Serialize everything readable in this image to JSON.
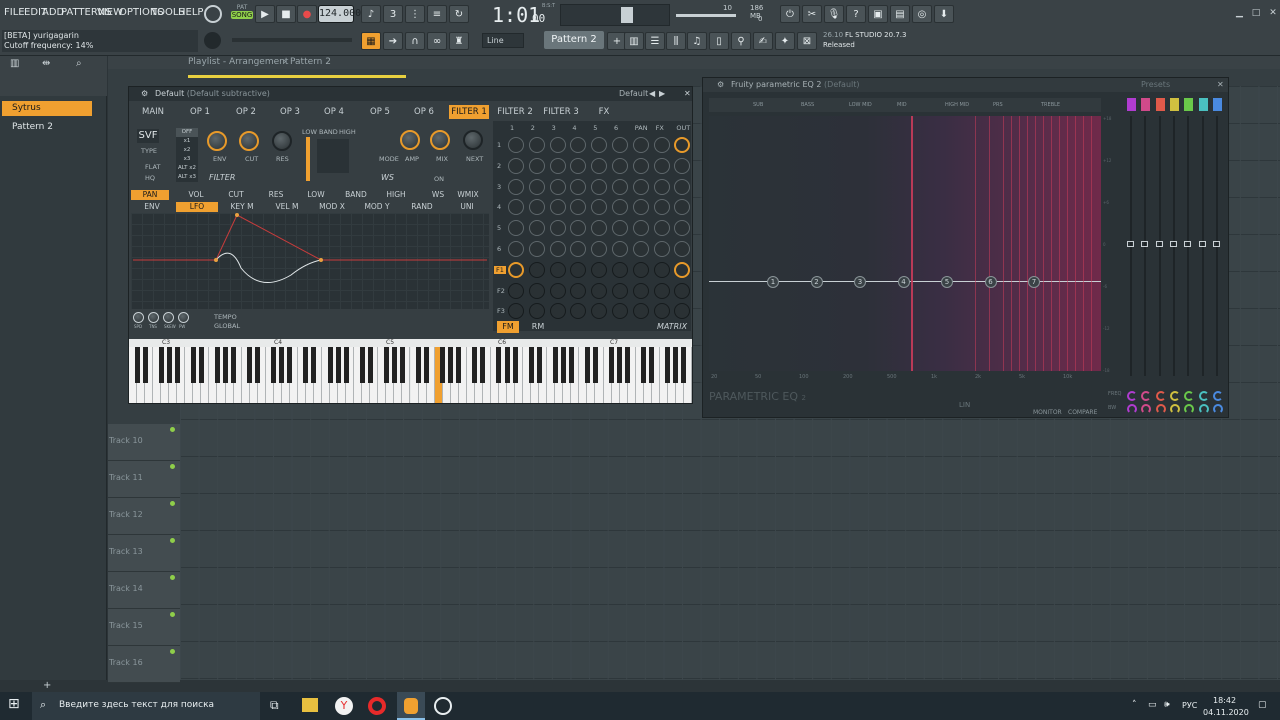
{
  "menubar": {
    "items": [
      "FILE",
      "EDIT",
      "ADD",
      "PATTERNS",
      "VIEW",
      "OPTIONS",
      "TOOLS",
      "HELP"
    ]
  },
  "transport": {
    "mode": "SONG",
    "mode_above": "PAT",
    "tempo": "124.000",
    "time": "1:01",
    "time_small": "00",
    "time_sig": "B:S:T",
    "memory": "186 MB",
    "cpu": "10",
    "voices": "0"
  },
  "hint": {
    "user": "[BETA] yurigagarin",
    "param": "Cutoff frequency: 14%"
  },
  "toolbar2": {
    "snap": "Line",
    "pattern": "Pattern 2"
  },
  "news": {
    "date": "26.10",
    "title": "FL STUDIO 20.7.3",
    "status": "Released"
  },
  "browser": {
    "items": [
      {
        "label": "Sytrus",
        "active": true
      },
      {
        "label": "Pattern 2",
        "active": false
      }
    ]
  },
  "playlist": {
    "breadcrumb": "Playlist - Arrangement",
    "sep": "›",
    "pattern": "Pattern 2",
    "tracks": [
      "Track 10",
      "Track 11",
      "Track 12",
      "Track 13",
      "Track 14",
      "Track 15",
      "Track 16"
    ]
  },
  "sytrus": {
    "title": "Default",
    "subtitle": "(Default subtractive)",
    "preset": "Default",
    "tabs": [
      "MAIN",
      "OP 1",
      "OP 2",
      "OP 3",
      "OP 4",
      "OP 5",
      "OP 6",
      "FILTER 1",
      "FILTER 2",
      "FILTER 3",
      "FX"
    ],
    "active_tab": "FILTER 1",
    "filter_type": "SVF",
    "type_label": "TYPE",
    "mult_options": [
      "OFF",
      "x1",
      "x2",
      "x3",
      "ALT x2",
      "ALT x3"
    ],
    "flat": "FLAT",
    "hq": "HQ",
    "knobs": [
      "ENV",
      "CUT",
      "RES"
    ],
    "band": [
      "LOW",
      "BAND",
      "HIGH"
    ],
    "mix_knobs": [
      "MODE",
      "AMP",
      "MIX",
      "NEXT"
    ],
    "filter_label": "FILTER",
    "ws_label": "WS",
    "on_label": "ON",
    "row1": [
      "PAN",
      "VOL",
      "CUT",
      "RES",
      "LOW",
      "BAND",
      "HIGH",
      "WS",
      "WMIX"
    ],
    "row1_active": "PAN",
    "row2": [
      "ENV",
      "LFO",
      "KEY M",
      "VEL M",
      "MOD X",
      "MOD Y",
      "RAND",
      "UNI"
    ],
    "row2_active": "LFO",
    "matrix_cols": [
      "1",
      "2",
      "3",
      "4",
      "5",
      "6",
      "PAN",
      "FX",
      "OUT"
    ],
    "matrix_rows": [
      "1",
      "2",
      "3",
      "4",
      "5",
      "6",
      "F1",
      "F2",
      "F3"
    ],
    "matrix_label": "MATRIX",
    "fm": "FM",
    "rm": "RM",
    "lfo_small": [
      "SPD",
      "TNS",
      "SKEW",
      "PW"
    ],
    "tempo": "TEMPO",
    "global": "GLOBAL",
    "octaves": [
      "C3",
      "C4",
      "C5",
      "C6",
      "C7"
    ]
  },
  "eq": {
    "title": "Fruity parametric EQ 2",
    "subtitle": "(Default)",
    "presets": "Presets",
    "bands": [
      "1",
      "2",
      "3",
      "4",
      "5",
      "6",
      "7"
    ],
    "band_names": [
      "SUB",
      "BASS",
      "LOW MID",
      "MID",
      "HIGH MID",
      "PRS",
      "TREBLE"
    ],
    "freq_labels": [
      "20",
      "50",
      "100",
      "200",
      "500",
      "1k",
      "2k",
      "5k",
      "10k"
    ],
    "db_labels": [
      "+18",
      "+12",
      "+6",
      "0",
      "-6",
      "-12",
      "-18"
    ],
    "logo": "PARAMETRIC EQ",
    "logo_num": "2",
    "lin": "LIN",
    "monitor": "MONITOR",
    "compare": "COMPARE",
    "freq": "FREQ",
    "bw": "BW",
    "band_colors": [
      "#b03cd0",
      "#d04a8a",
      "#e05a4a",
      "#d0c040",
      "#6ac84a",
      "#4ac0c0",
      "#4a8ae0"
    ]
  },
  "taskbar": {
    "search": "Введите здесь текст для поиска",
    "lang": "РУС",
    "time": "18:42",
    "date": "04.11.2020"
  }
}
